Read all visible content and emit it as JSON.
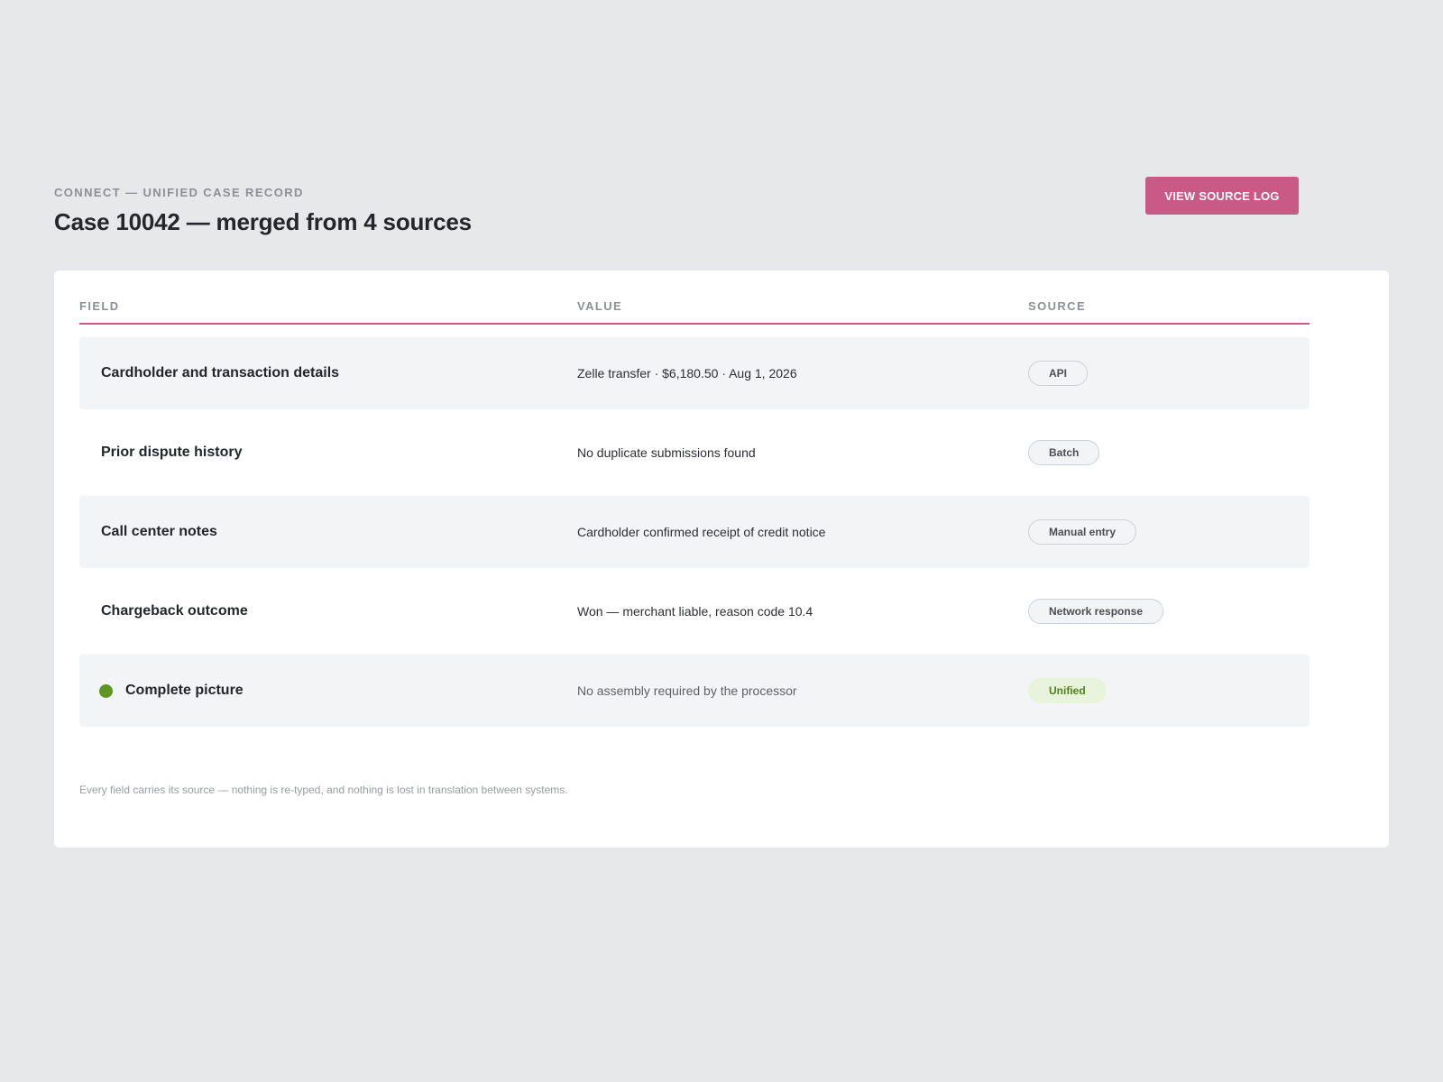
{
  "header": {
    "eyebrow": "CONNECT — UNIFIED CASE RECORD",
    "title": "Case 10042 — merged from 4 sources",
    "action_label": "VIEW SOURCE LOG"
  },
  "table": {
    "columns": [
      "FIELD",
      "VALUE",
      "SOURCE"
    ],
    "rows": [
      {
        "field": "Cardholder and transaction details",
        "value": "Zelle transfer · $6,180.50 · Aug 1, 2026",
        "source": "API"
      },
      {
        "field": "Prior dispute history",
        "value": "No duplicate submissions found",
        "source": "Batch"
      },
      {
        "field": "Call center notes",
        "value": "Cardholder confirmed receipt of credit notice",
        "source": "Manual entry"
      },
      {
        "field": "Chargeback outcome",
        "value": "Won — merchant liable, reason code 10.4",
        "source": "Network response"
      },
      {
        "field": "Complete picture",
        "value": "No assembly required by the processor",
        "source": "Unified"
      }
    ]
  },
  "footnote": "Every field carries its source — nothing is re-typed, and nothing is lost in translation between systems.",
  "colors": {
    "accent": "#c95a86",
    "background": "#e7e8ea",
    "card": "#ffffff",
    "row_shade": "#f3f4f5",
    "status_green": "#5e9624",
    "unified_pill_bg": "#e8f3db",
    "unified_pill_text": "#4f7f1f"
  }
}
